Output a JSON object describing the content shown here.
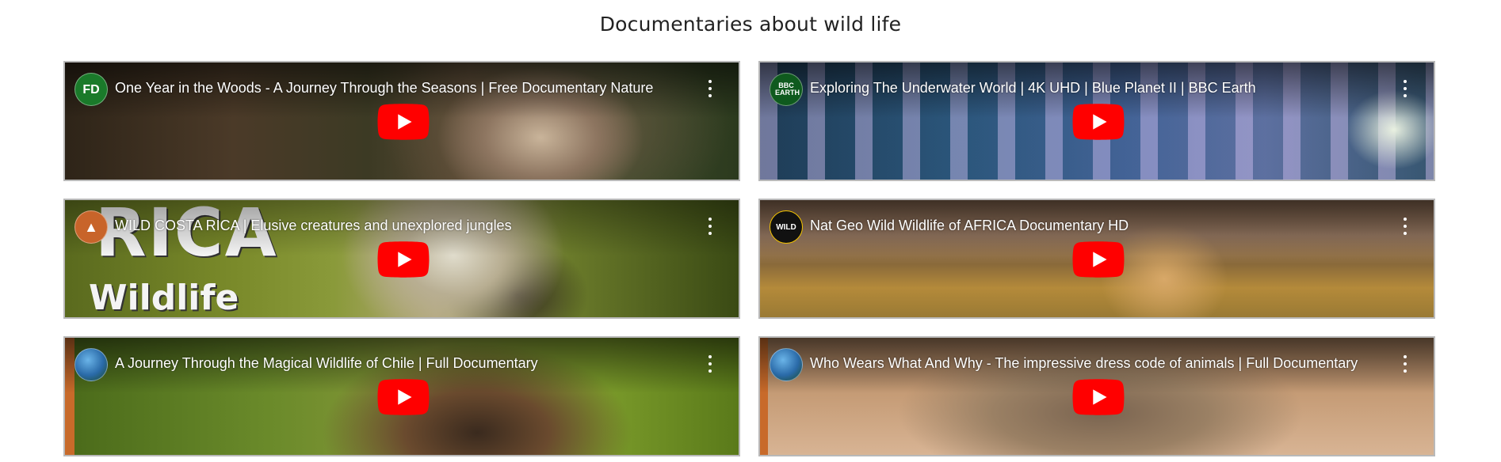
{
  "page": {
    "title": "Documentaries about wild life"
  },
  "colors": {
    "youtube_red": "#ff0000",
    "border": "#b9b9b9"
  },
  "icons": {
    "play": "youtube-play-icon",
    "menu": "more-vert-icon"
  },
  "videos": [
    {
      "title": "One Year in the Woods - A Journey Through the Seasons | Free Documentary Nature",
      "channel_badge": "FD",
      "channel_icon": "free-documentary-logo"
    },
    {
      "title": "Exploring The Underwater World | 4K UHD | Blue Planet II | BBC Earth",
      "channel_badge": "BBC EARTH",
      "channel_icon": "bbc-earth-logo"
    },
    {
      "title": "WILD COSTA RICA | Elusive creatures and unexplored jungles",
      "channel_badge": "",
      "channel_icon": "fox-avatar",
      "thumbnail_text_1": "RICA",
      "thumbnail_text_2": "Wildlife"
    },
    {
      "title": "Nat Geo Wild Wildlife of AFRICA Documentary HD",
      "channel_badge": "WILD",
      "channel_icon": "nat-geo-wild-logo"
    },
    {
      "title": "A Journey Through the Magical Wildlife of Chile | Full Documentary",
      "channel_badge": "",
      "channel_icon": "globe-avatar"
    },
    {
      "title": "Who Wears What And Why - The impressive dress code of animals | Full Documentary",
      "channel_badge": "",
      "channel_icon": "globe-avatar"
    }
  ]
}
